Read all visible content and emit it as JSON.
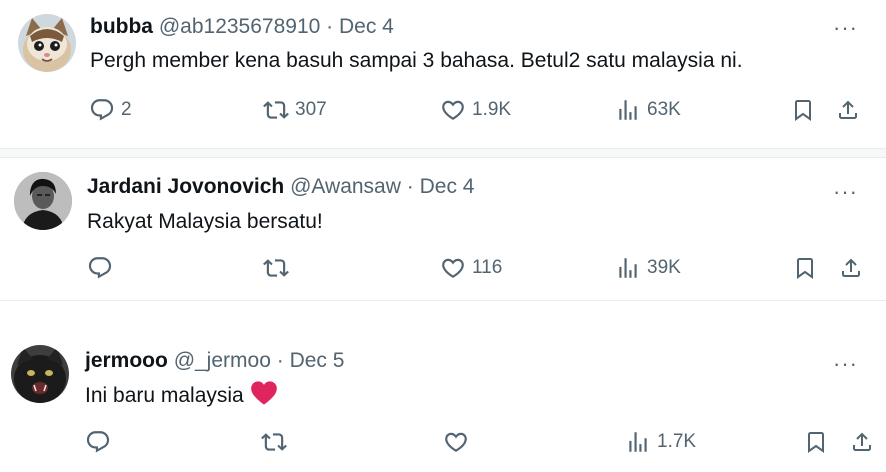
{
  "tweets": [
    {
      "name": "bubba",
      "handle": "@ab1235678910",
      "dot": "·",
      "date": "Dec 4",
      "text": "Pergh member kena basuh sampai 3 bahasa. Betul2 satu malaysia ni.",
      "replies": "2",
      "retweets": "307",
      "likes": "1.9K",
      "views": "63K"
    },
    {
      "name": "Jardani Jovonovich",
      "handle": "@Awansaw",
      "dot": "·",
      "date": "Dec 4",
      "text": "Rakyat Malaysia bersatu!",
      "replies": "",
      "retweets": "",
      "likes": "116",
      "views": "39K"
    },
    {
      "name": "jermooo",
      "handle": "@_jermoo",
      "dot": "·",
      "date": "Dec 5",
      "text": "Ini baru malaysia",
      "replies": "",
      "retweets": "",
      "likes": "",
      "views": "1.7K"
    }
  ],
  "icons": {
    "reply": "speech-bubble-icon",
    "retweet": "retweet-arrows-icon",
    "like": "heart-outline-icon",
    "views": "bar-chart-icon",
    "bookmark": "bookmark-icon",
    "share": "share-upload-icon",
    "more": "more-dots-icon",
    "emoji": "red-heart-emoji"
  },
  "colors": {
    "text": "#0f1419",
    "secondary": "#536471",
    "divider": "#eff3f4",
    "heart": "#e0245e"
  }
}
